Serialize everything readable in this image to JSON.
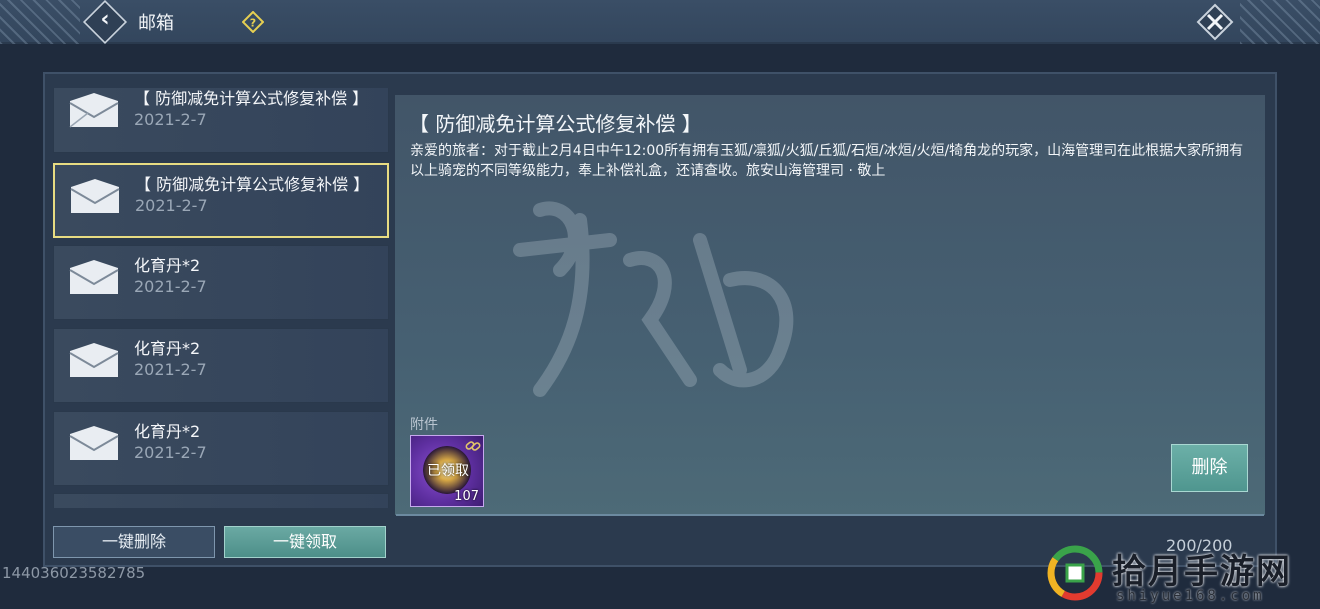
{
  "header": {
    "title": "邮箱",
    "back_icon": "chevron-left-icon",
    "help_icon": "question-diamond-icon",
    "close_icon": "close-x-icon"
  },
  "mail_list": [
    {
      "subject": "【 防御减免计算公式修复补偿 】",
      "date": "2021-2-7",
      "selected": false
    },
    {
      "subject": "【 防御减免计算公式修复补偿 】",
      "date": "2021-2-7",
      "selected": true
    },
    {
      "subject": "化育丹*2",
      "date": "2021-2-7",
      "selected": false
    },
    {
      "subject": "化育丹*2",
      "date": "2021-2-7",
      "selected": false
    },
    {
      "subject": "化育丹*2",
      "date": "2021-2-7",
      "selected": false
    }
  ],
  "detail": {
    "title": "【 防御减免计算公式修复补偿 】",
    "body": "亲爱的旅者：对于截止2月4日中午12:00所有拥有玉狐/凛狐/火狐/丘狐/石烜/冰烜/火烜/犄角龙的玩家，山海管理司在此根据大家所拥有以上骑宠的不同等级能力，奉上补偿礼盒，还请查收。旅安山海管理司 · 敬上",
    "attachments_label": "附件",
    "attachment": {
      "status": "已领取",
      "count": "107",
      "icon": "link-chain-icon"
    },
    "delete_label": "删除"
  },
  "footer": {
    "delete_all_label": "一键删除",
    "claim_all_label": "一键领取",
    "capacity": "200/200",
    "uid": "144036023582785"
  },
  "site_watermark": {
    "name": "拾月手游网",
    "url": "shiyue168.com"
  },
  "colors": {
    "selected_border": "#e8dc82",
    "accent_teal": "#5a9f98",
    "attachment_purple": "#5e2fa0"
  }
}
